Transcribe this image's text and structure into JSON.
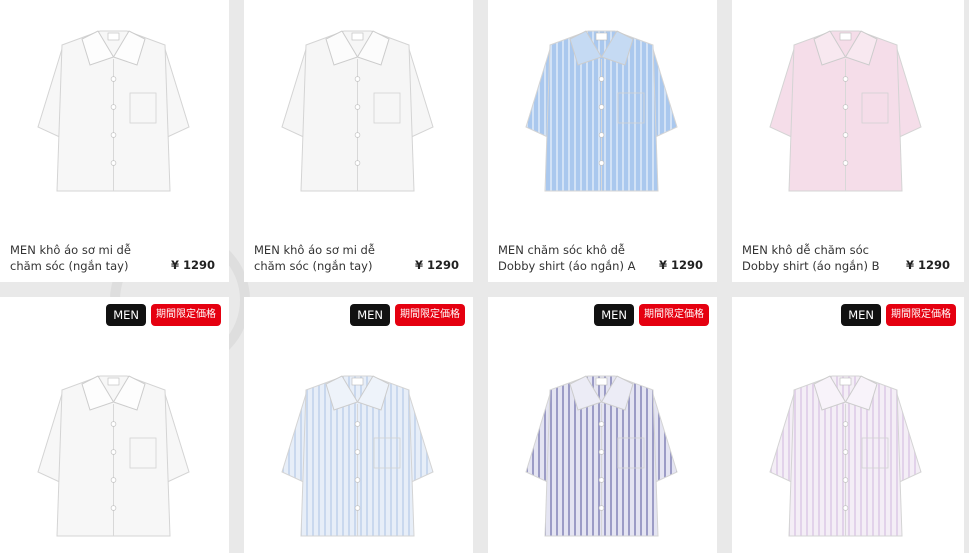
{
  "products": [
    {
      "name_line1": "MEN khô áo sơ mi dễ",
      "name_line2": "chăm sóc (ngắn tay)",
      "price": "¥ 1290",
      "shirt_color": "#f7f7f7",
      "stripe_color": "",
      "collar_color": "#fdfdfd"
    },
    {
      "name_line1": "MEN khô áo sơ mi dễ",
      "name_line2": "chăm sóc (ngắn tay)",
      "price": "¥ 1290",
      "shirt_color": "#f6f6f6",
      "stripe_color": "",
      "collar_color": "#fcfcfc"
    },
    {
      "name_line1": "MEN chăm sóc khô dễ",
      "name_line2": "Dobby shirt (áo ngắn) A",
      "price": "¥ 1290",
      "shirt_color": "#aac8ee",
      "stripe_color": "#d2e2f6",
      "collar_color": "#c5daf3"
    },
    {
      "name_line1": "MEN khô dễ chăm sóc",
      "name_line2": "Dobby shirt (áo ngắn) B",
      "price": "¥ 1290",
      "shirt_color": "#f5dde9",
      "stripe_color": "",
      "collar_color": "#f8e8f0"
    },
    {
      "tag_men": "MEN",
      "tag_sale": "期間限定価格",
      "shirt_color": "#f7f7f7",
      "stripe_color": "",
      "collar_color": "#fdfdfd"
    },
    {
      "tag_men": "MEN",
      "tag_sale": "期間限定価格",
      "shirt_color": "#e7eef8",
      "stripe_color": "#c9d8ee",
      "collar_color": "#eef3fa"
    },
    {
      "tag_men": "MEN",
      "tag_sale": "期間限定価格",
      "shirt_color": "#e4e4f2",
      "stripe_color": "#9c9cc6",
      "collar_color": "#ececf6"
    },
    {
      "tag_men": "MEN",
      "tag_sale": "期間限定価格",
      "shirt_color": "#f4eef6",
      "stripe_color": "#e2d2ea",
      "collar_color": "#f8f3fa"
    }
  ]
}
